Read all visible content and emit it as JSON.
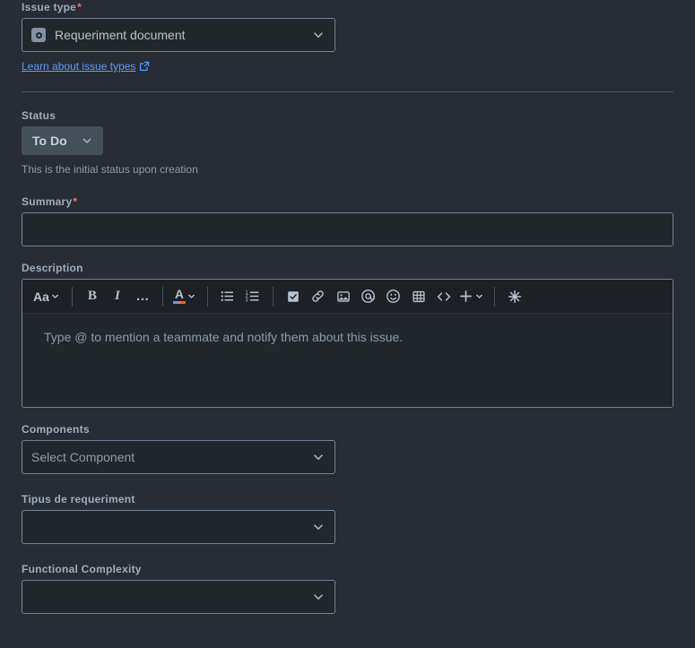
{
  "form": {
    "issue_type": {
      "label": "Issue type",
      "required_marker": "*",
      "selected": "Requeriment document",
      "icon": "issue-type-document-icon",
      "chevron": "chevron-down-icon",
      "help_link": {
        "text": "Learn about issue types",
        "icon": "external-link-icon",
        "color": "#579DFF"
      }
    },
    "status": {
      "label": "Status",
      "value": "To Do",
      "chevron": "chevron-down-icon",
      "helper": "This is the initial status upon creation",
      "badge_color": "#454F59"
    },
    "summary": {
      "label": "Summary",
      "required_marker": "*",
      "value": "",
      "placeholder": ""
    },
    "description": {
      "label": "Description",
      "placeholder": "Type @ to mention a teammate and notify them about this issue.",
      "toolbar": [
        {
          "name": "text-style-button",
          "label": "Aa",
          "has_caret": true
        },
        {
          "name": "separator-1",
          "label": "",
          "type": "separator"
        },
        {
          "name": "bold-button",
          "label": "B"
        },
        {
          "name": "italic-button",
          "label": "I"
        },
        {
          "name": "more-formatting-button",
          "label": "…"
        },
        {
          "name": "separator-2",
          "label": "",
          "type": "separator"
        },
        {
          "name": "text-color-button",
          "label": "A",
          "has_caret": true
        },
        {
          "name": "separator-3",
          "label": "",
          "type": "separator"
        },
        {
          "name": "bullet-list-button",
          "label": ""
        },
        {
          "name": "ordered-list-button",
          "label": ""
        },
        {
          "name": "separator-4",
          "label": "",
          "type": "separator"
        },
        {
          "name": "task-list-button",
          "label": ""
        },
        {
          "name": "link-button",
          "label": ""
        },
        {
          "name": "image-button",
          "label": ""
        },
        {
          "name": "mention-button",
          "label": "@"
        },
        {
          "name": "emoji-button",
          "label": ""
        },
        {
          "name": "table-button",
          "label": ""
        },
        {
          "name": "code-block-button",
          "label": "<>"
        },
        {
          "name": "insert-more-button",
          "label": "+",
          "has_caret": true
        },
        {
          "name": "separator-5",
          "label": "",
          "type": "separator"
        },
        {
          "name": "ai-assist-button",
          "label": ""
        }
      ]
    },
    "components": {
      "label": "Components",
      "placeholder": "Select Component",
      "value": "",
      "chevron": "chevron-down-icon"
    },
    "tipus_de_requeriment": {
      "label": "Tipus de requeriment",
      "value": "",
      "chevron": "chevron-down-icon"
    },
    "functional_complexity": {
      "label": "Functional Complexity",
      "value": "",
      "chevron": "chevron-down-icon"
    }
  },
  "theme": {
    "background": "#282C34",
    "field_background": "#22272B",
    "toolbar_background": "#1D2125",
    "border": "#738496",
    "text": "#B6C2CF",
    "muted_text": "#8C9BAB",
    "link": "#579DFF",
    "required": "#F87168"
  }
}
